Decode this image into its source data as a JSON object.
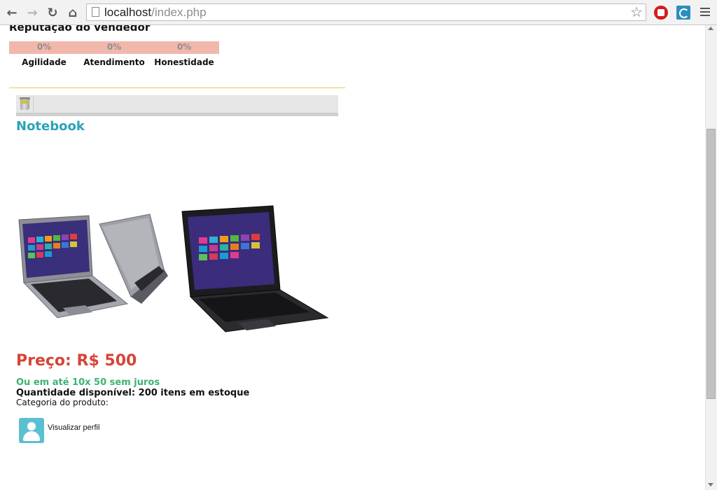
{
  "browser": {
    "url_host": "localhost",
    "url_path": "/index.php",
    "icons": [
      "back-icon",
      "forward-icon",
      "reload-icon",
      "home-icon",
      "page-icon",
      "star-icon",
      "stop-extension-icon",
      "c-extension-icon",
      "menu-icon"
    ]
  },
  "reputation": {
    "title": "Reputação do vendedor",
    "metrics": [
      {
        "value": "0%",
        "label": "Agilidade"
      },
      {
        "value": "0%",
        "label": "Atendimento"
      },
      {
        "value": "0%",
        "label": "Honestidade"
      }
    ]
  },
  "product": {
    "title": "Notebook",
    "price": "Preço: R$ 500",
    "installments": "Ou em até 10x 50 sem juros",
    "stock": "Quantidade disponível: 200 itens em estoque",
    "category": "Categoria do produto:",
    "profile_link": "Visualizar perfil"
  },
  "colors": {
    "title_teal": "#2aa3b8",
    "price_red": "#d64537",
    "installments_green": "#3cb371",
    "rep_bar": "#f2b7ab",
    "divider_yellow": "#e2cf4c"
  }
}
